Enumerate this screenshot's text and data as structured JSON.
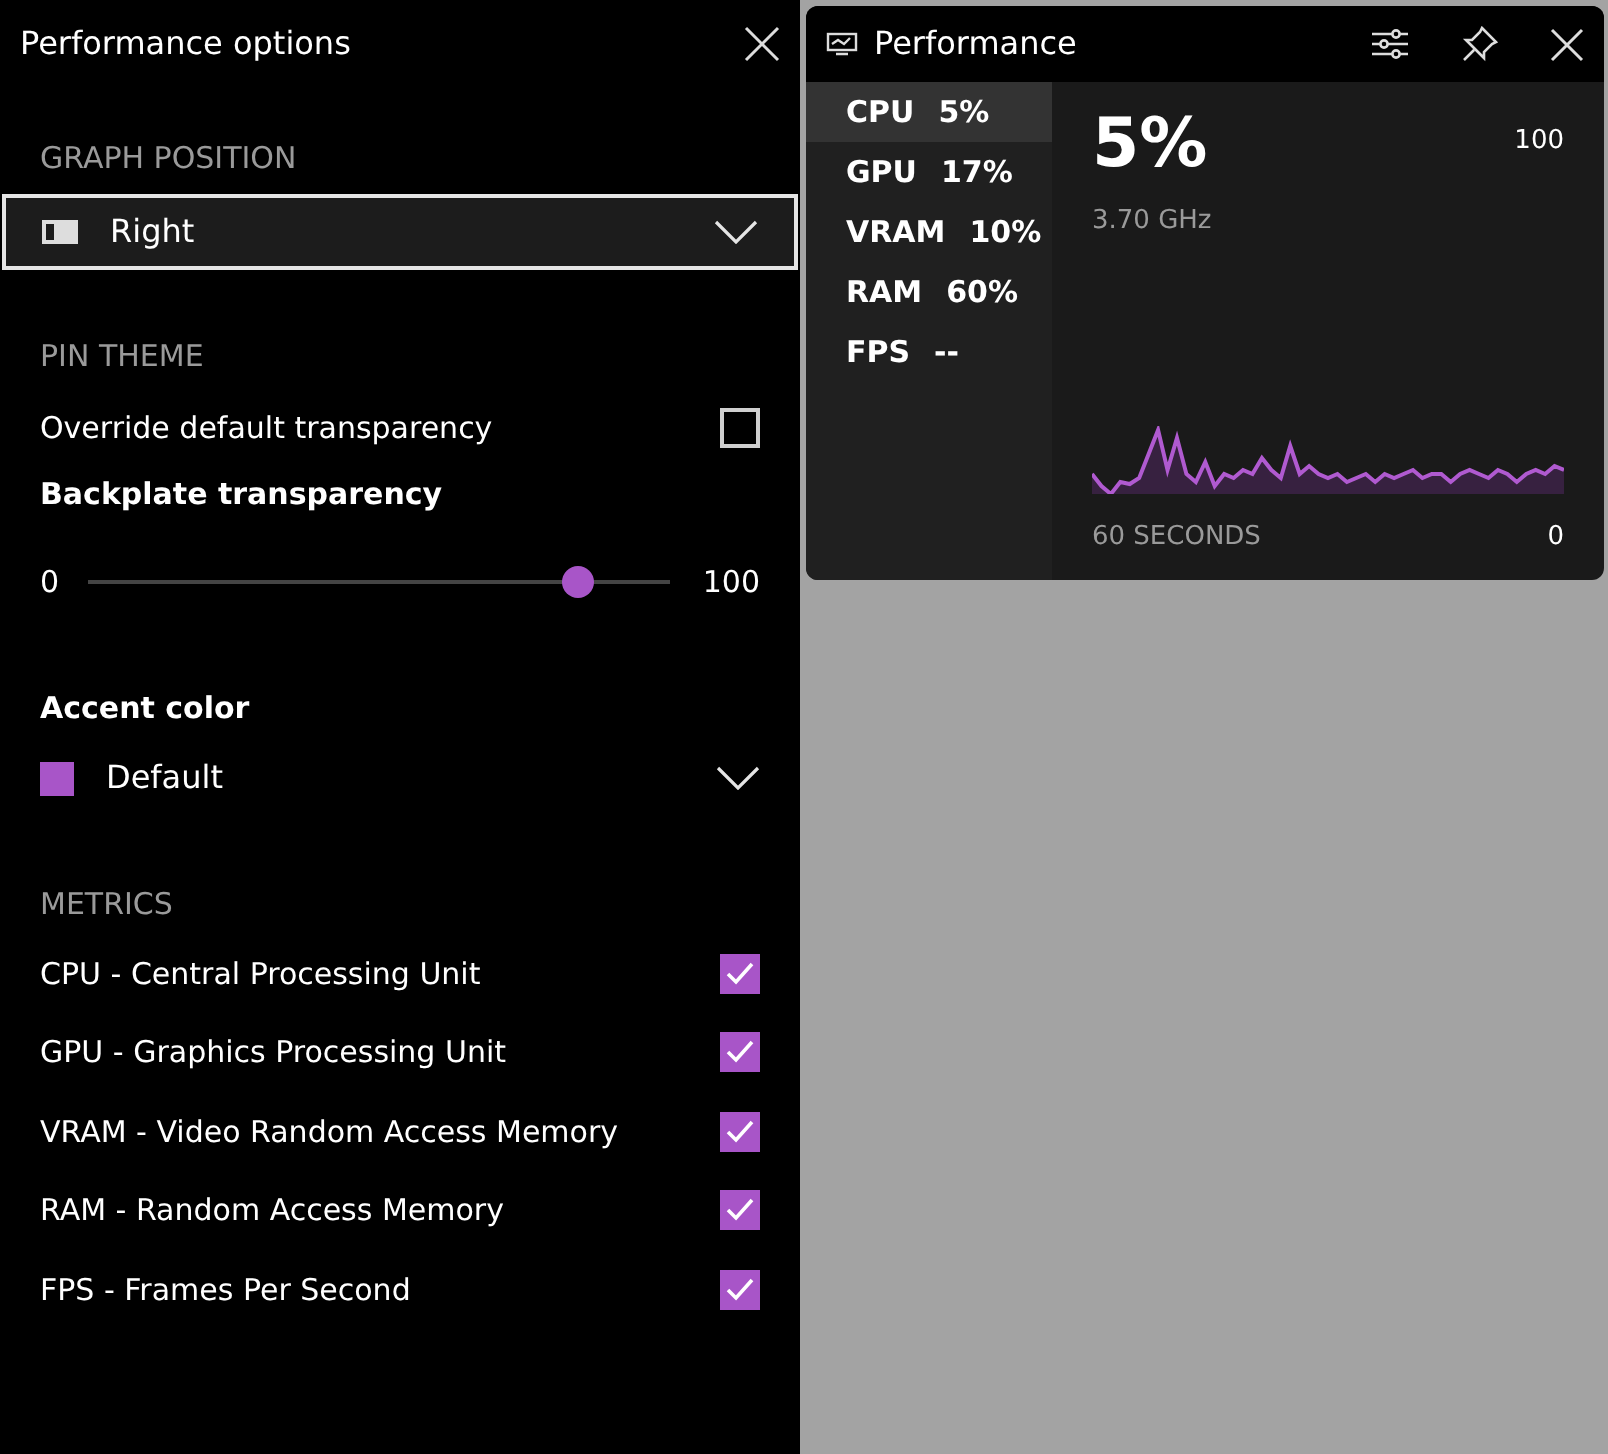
{
  "options_panel": {
    "title": "Performance options",
    "graph_position": {
      "heading": "GRAPH POSITION",
      "value": "Right"
    },
    "pin_theme": {
      "heading": "PIN THEME",
      "override_label": "Override default transparency",
      "override_checked": false,
      "backplate_label": "Backplate transparency",
      "min": "0",
      "max": "100",
      "level": 0.84
    },
    "accent": {
      "label": "Accent color",
      "value": "Default",
      "color": "#a855c8"
    },
    "metrics": {
      "heading": "METRICS",
      "items": [
        {
          "label": "CPU - Central Processing Unit",
          "checked": true
        },
        {
          "label": "GPU - Graphics Processing Unit",
          "checked": true
        },
        {
          "label": "VRAM - Video Random Access Memory",
          "checked": true
        },
        {
          "label": "RAM - Random Access Memory",
          "checked": true
        },
        {
          "label": "FPS - Frames Per Second",
          "checked": true
        }
      ]
    }
  },
  "widget": {
    "title": "Performance",
    "metrics": [
      {
        "name": "CPU",
        "value": "5%",
        "selected": true
      },
      {
        "name": "GPU",
        "value": "17%",
        "selected": false
      },
      {
        "name": "VRAM",
        "value": "10%",
        "selected": false
      },
      {
        "name": "RAM",
        "value": "60%",
        "selected": false
      },
      {
        "name": "FPS",
        "value": "--",
        "selected": false
      }
    ],
    "big_value": "5%",
    "frequency": "3.70 GHz",
    "scale_max": "100",
    "scale_min": "0",
    "time_span": "60 SECONDS"
  }
}
